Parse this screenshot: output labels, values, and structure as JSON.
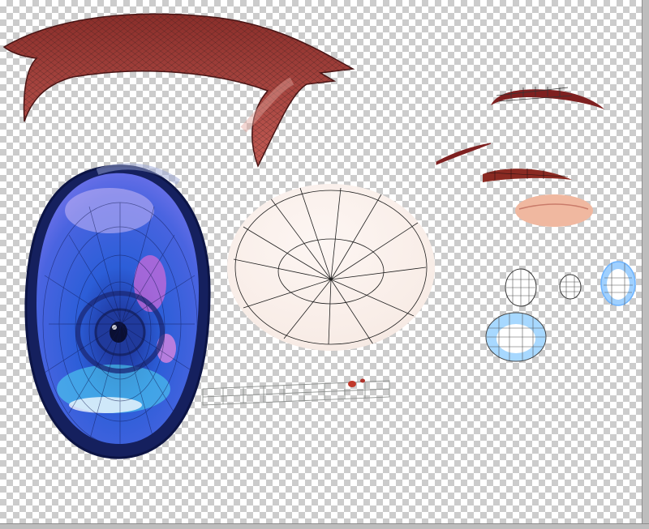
{
  "canvas": {
    "background": "transparent-checkerboard",
    "parts": [
      {
        "name": "upper-eyelash",
        "color": "#a84440"
      },
      {
        "name": "eye-outline",
        "color": "#15205e"
      },
      {
        "name": "iris",
        "color": "#3f55d8"
      },
      {
        "name": "eye-white",
        "color": "#fbf2ee"
      },
      {
        "name": "lower-eyelid",
        "color": "#8f9290"
      },
      {
        "name": "eyebrow",
        "color": "#7e2020"
      },
      {
        "name": "double-eyelid-line",
        "color": "#7e2020"
      },
      {
        "name": "eyelid-shadow",
        "color": "#8a2a22"
      },
      {
        "name": "skin-blush",
        "color": "#f0b8a0"
      },
      {
        "name": "highlight-small",
        "color": "#ffffff"
      },
      {
        "name": "highlight-tiny",
        "color": "#ffffff"
      },
      {
        "name": "highlight-blue-ring",
        "color": "#9fd0ff"
      },
      {
        "name": "highlight-large-ring",
        "color": "#a7d8ff"
      }
    ]
  }
}
